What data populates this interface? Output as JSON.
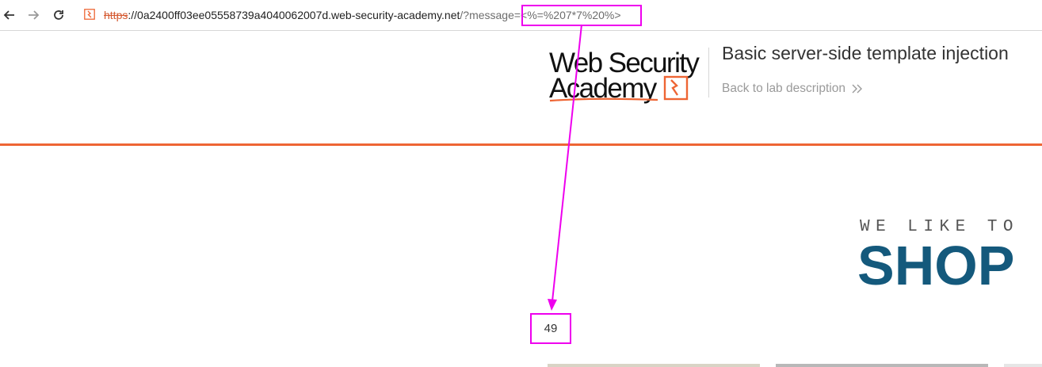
{
  "browser": {
    "url_scheme": "https",
    "url_host_rest": "://0a2400ff03ee05558739a4040062007d.web-security-academy.net",
    "url_path": "/?message",
    "url_query": "=<%=%207*7%20%>",
    "icons": [
      "back-arrow-icon",
      "forward-arrow-icon",
      "reload-icon",
      "site-lab-icon"
    ]
  },
  "header": {
    "logo_line1": "Web Security",
    "logo_line2": "Academy",
    "lab_title": "Basic server-side template injection",
    "back_link": "Back to lab description"
  },
  "banner": {
    "tagline": "WE LIKE TO",
    "headline": "SHOP"
  },
  "message": {
    "value": "49"
  },
  "colors": {
    "accent_orange": "#ee6534",
    "shop_blue": "#14597c",
    "annotation_magenta": "#ee00ee"
  }
}
